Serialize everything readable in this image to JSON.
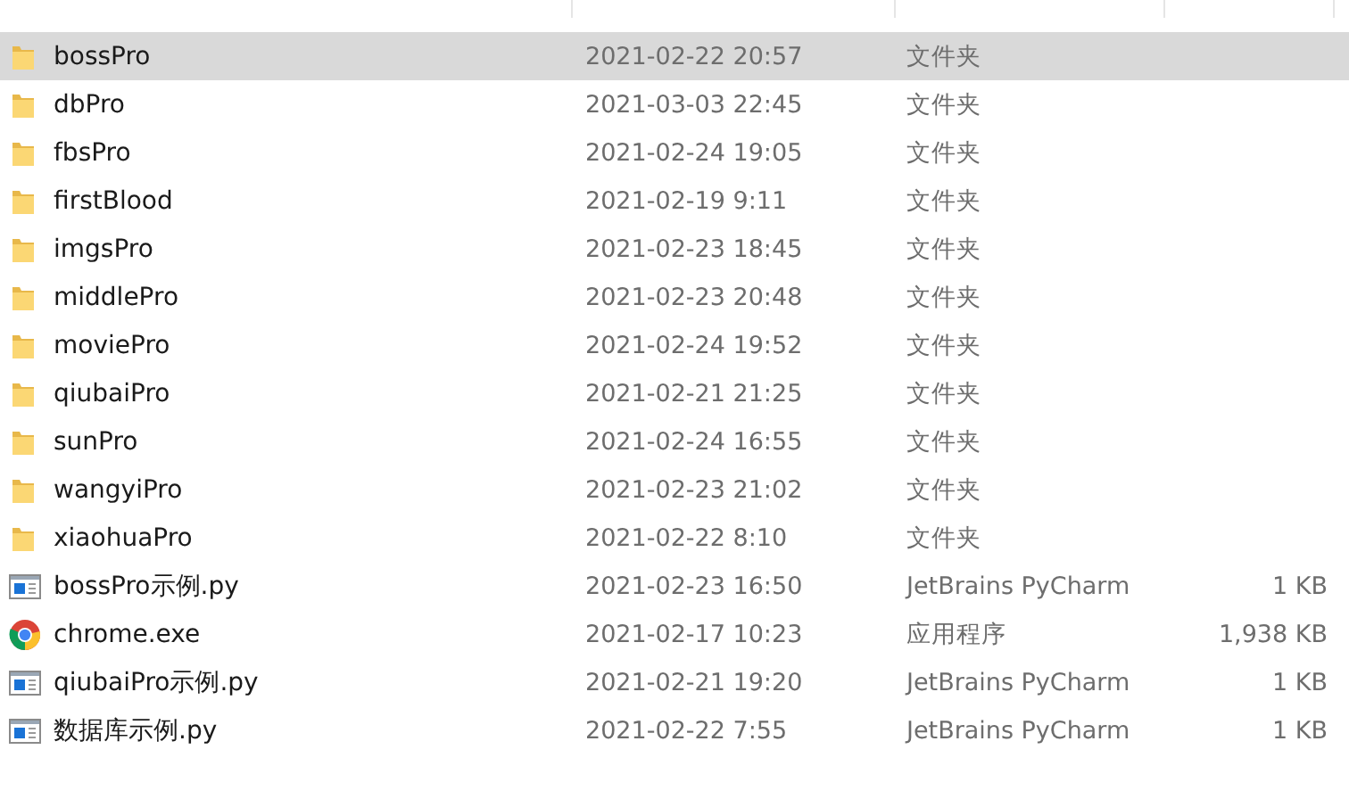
{
  "files": [
    {
      "name": "bossPro",
      "modified": "2021-02-22 20:57",
      "type": "文件夹",
      "kind": "folder",
      "selected": true
    },
    {
      "name": "dbPro",
      "modified": "2021-03-03 22:45",
      "type": "文件夹",
      "kind": "folder",
      "selected": false
    },
    {
      "name": "fbsPro",
      "modified": "2021-02-24 19:05",
      "type": "文件夹",
      "kind": "folder",
      "selected": false
    },
    {
      "name": "firstBlood",
      "modified": "2021-02-19 9:11",
      "type": "文件夹",
      "kind": "folder",
      "selected": false
    },
    {
      "name": "imgsPro",
      "modified": "2021-02-23 18:45",
      "type": "文件夹",
      "kind": "folder",
      "selected": false
    },
    {
      "name": "middlePro",
      "modified": "2021-02-23 20:48",
      "type": "文件夹",
      "kind": "folder",
      "selected": false
    },
    {
      "name": "moviePro",
      "modified": "2021-02-24 19:52",
      "type": "文件夹",
      "kind": "folder",
      "selected": false
    },
    {
      "name": "qiubaiPro",
      "modified": "2021-02-21 21:25",
      "type": "文件夹",
      "kind": "folder",
      "selected": false
    },
    {
      "name": "sunPro",
      "modified": "2021-02-24 16:55",
      "type": "文件夹",
      "kind": "folder",
      "selected": false
    },
    {
      "name": "wangyiPro",
      "modified": "2021-02-23 21:02",
      "type": "文件夹",
      "kind": "folder",
      "selected": false
    },
    {
      "name": "xiaohuaPro",
      "modified": "2021-02-22 8:10",
      "type": "文件夹",
      "kind": "folder",
      "selected": false
    },
    {
      "name": "bossPro示例.py",
      "modified": "2021-02-23 16:50",
      "type": "JetBrains PyCharm",
      "size": "1 KB",
      "kind": "script",
      "selected": false
    },
    {
      "name": "chrome.exe",
      "modified": "2021-02-17 10:23",
      "type": "应用程序",
      "size": "1,938 KB",
      "kind": "app",
      "selected": false
    },
    {
      "name": "qiubaiPro示例.py",
      "modified": "2021-02-21 19:20",
      "type": "JetBrains PyCharm",
      "size": "1 KB",
      "kind": "script",
      "selected": false
    },
    {
      "name": "数据库示例.py",
      "modified": "2021-02-22 7:55",
      "type": "JetBrains PyCharm",
      "size": "1 KB",
      "kind": "script",
      "selected": false
    }
  ]
}
